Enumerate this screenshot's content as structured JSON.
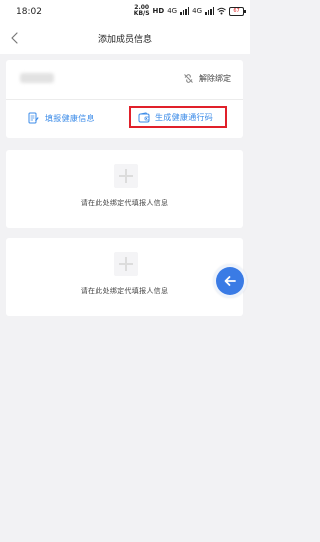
{
  "status_bar": {
    "time": "18:02",
    "speed_value": "2.00",
    "speed_unit": "KB/S",
    "hd": "HD",
    "net_a": "4G",
    "net_b": "4G",
    "battery": "67"
  },
  "nav": {
    "title": "添加成员信息"
  },
  "member_card": {
    "unbind_label": "解除绑定",
    "fill_info_label": "填报健康信息",
    "generate_label": "生成健康通行码"
  },
  "empty_slots": [
    {
      "hint": "请在此处绑定代填报人信息"
    },
    {
      "hint": "请在此处绑定代填报人信息"
    }
  ],
  "colors": {
    "accent": "#3b8be8",
    "highlight_border": "#e0202a",
    "float_button": "#3a7be5"
  },
  "icons": {
    "back": "chevron-left",
    "unbind": "broken-link",
    "fill_info": "document-edit",
    "generate": "wallet-card",
    "float_back": "arrow-left"
  }
}
